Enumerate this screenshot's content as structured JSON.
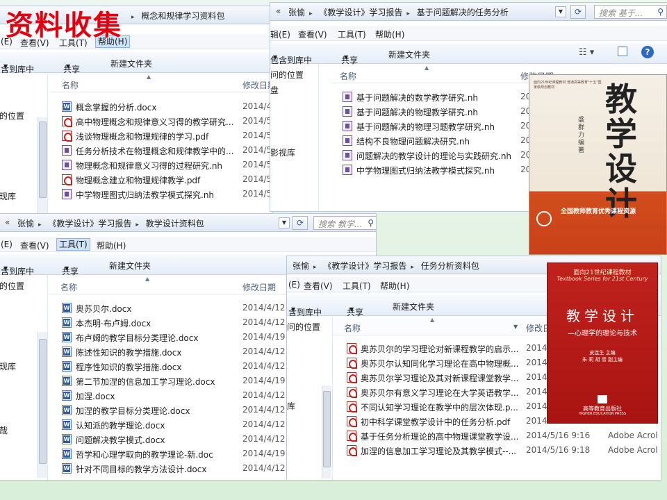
{
  "slide_title": "资料收集",
  "win1": {
    "breadcrumb": "概念和规律学习资料包",
    "menu": [
      "(E)",
      "查看(V)",
      "工具(T)",
      "帮助(H)"
    ],
    "toolbar": [
      "含到库中",
      "共享",
      "新建文件夹"
    ],
    "side": [
      "的位置",
      "现库"
    ],
    "col_name": "名称",
    "col_date": "修改日期",
    "files": [
      {
        "icon": "docx",
        "name": "概念掌握的分析.docx",
        "date": "2014/4"
      },
      {
        "icon": "pdf",
        "name": "高中物理概念和规律意义习得的教学研究...",
        "date": "2014/5"
      },
      {
        "icon": "pdf",
        "name": "浅谈物理概念和物理规律的学习.pdf",
        "date": "2014/5"
      },
      {
        "icon": "nh",
        "name": "任务分析技术在物理概念和规律教学中的...",
        "date": "2014/5"
      },
      {
        "icon": "nh",
        "name": "物理概念和规律意义习得的过程研究.nh",
        "date": "2014/5"
      },
      {
        "icon": "pdf",
        "name": "物理概念建立和物理规律教学.pdf",
        "date": "2014/5"
      },
      {
        "icon": "nh",
        "name": "中学物理图式归纳法教学模式探究.nh",
        "date": "2014/5"
      }
    ]
  },
  "win2": {
    "breadcrumb": [
      "张愉",
      "《教学设计》学习报告",
      "基于问题解决的任务分析"
    ],
    "search_placeholder": "搜索 基于...",
    "menu": [
      "辑(E)",
      "查看(V)",
      "工具(T)",
      "帮助(H)"
    ],
    "toolbar": [
      "包含到库中",
      "共享",
      "新建文件夹"
    ],
    "side": [
      "问的位置",
      "盘",
      "影视库"
    ],
    "col_name": "名称",
    "col_date": "修改日期",
    "files": [
      {
        "icon": "nh",
        "name": "基于问题解决的数学教学研究.nh",
        "date": "20"
      },
      {
        "icon": "nh",
        "name": "基于问题解决的物理教学研究.nh",
        "date": "20"
      },
      {
        "icon": "nh",
        "name": "基于问题解决的物理习题教学研究.nh",
        "date": "20"
      },
      {
        "icon": "nh",
        "name": "结构不良物理问题解决研究.nh",
        "date": "20"
      },
      {
        "icon": "nh",
        "name": "问题解决的教学设计的理论与实践研究.nh",
        "date": "20"
      },
      {
        "icon": "nh",
        "name": "中学物理图式归纳法教学模式探究.nh",
        "date": "20"
      }
    ]
  },
  "win3": {
    "breadcrumb": [
      "张愉",
      "《教学设计》学习报告",
      "教学设计资料包"
    ],
    "search_placeholder": "搜索 教学...",
    "menu": [
      "(E)",
      "查看(V)",
      "工具(T)",
      "帮助(H)"
    ],
    "toolbar": [
      "含到库中",
      "共享",
      "新建文件夹"
    ],
    "side": [
      "的位置",
      "现库",
      "哉"
    ],
    "col_name": "名称",
    "col_date": "修改日期",
    "files": [
      {
        "icon": "docx",
        "name": "奥苏贝尔.docx",
        "date": "2014/4/12 1"
      },
      {
        "icon": "docx",
        "name": "本杰明·布卢姆.docx",
        "date": "2014/4/12 1"
      },
      {
        "icon": "docx",
        "name": "布卢姆的教学目标分类理论.docx",
        "date": "2014/4/19 1"
      },
      {
        "icon": "docx",
        "name": "陈述性知识的教学措施.docx",
        "date": "2014/4/12 1"
      },
      {
        "icon": "docx",
        "name": "程序性知识的教学措施.docx",
        "date": "2014/4/12 1"
      },
      {
        "icon": "docx",
        "name": "第二节加涅的信息加工学习理论.docx",
        "date": "2014/4/19 1"
      },
      {
        "icon": "docx",
        "name": "加涅.docx",
        "date": "2014/4/12 1"
      },
      {
        "icon": "docx",
        "name": "加涅的教学目标分类理论.docx",
        "date": "2014/4/12 1"
      },
      {
        "icon": "docx",
        "name": "认知派的教学理论.docx",
        "date": "2014/4/12 1"
      },
      {
        "icon": "docx",
        "name": "问题解决教学模式.docx",
        "date": "2014/4/12 1"
      },
      {
        "icon": "docx",
        "name": "哲学和心理学取向的教学理论-新.doc",
        "date": "2014/4/19 1"
      },
      {
        "icon": "docx",
        "name": "针对不同目标的教学方法设计.docx",
        "date": "2014/4/12 1"
      }
    ]
  },
  "win4": {
    "breadcrumb": [
      "张愉",
      "《教学设计》学习报告",
      "任务分析资料包"
    ],
    "menu": [
      "(E)",
      "查看(V)",
      "工具(T)",
      "帮助(H)"
    ],
    "toolbar": [
      "含到库中",
      "共享",
      "新建文件夹"
    ],
    "side": [
      "问的位置",
      "库"
    ],
    "col_name": "名称",
    "col_date": "修改日",
    "files": [
      {
        "icon": "pdf",
        "name": "奥苏贝尔的学习理论对新课程教学的启示...",
        "date": "2014",
        "type": ""
      },
      {
        "icon": "pdf",
        "name": "奥苏贝尔认知同化学习理论在高中物理概...",
        "date": "2014",
        "type": ""
      },
      {
        "icon": "pdf",
        "name": "奥苏贝尔学习理论及其对新课程课堂教学...",
        "date": "2014",
        "type": ""
      },
      {
        "icon": "pdf",
        "name": "奥苏贝尔有意义学习理论在大学英语教学...",
        "date": "2014",
        "type": ""
      },
      {
        "icon": "pdf",
        "name": "不同认知学习理论在教学中的层次体现.p...",
        "date": "2014",
        "type": ""
      },
      {
        "icon": "pdf",
        "name": "初中科学课堂教学设计中的任务分析.pdf",
        "date": "2014",
        "type": ""
      },
      {
        "icon": "pdf",
        "name": "基于任务分析理论的高中物理课堂教学设...",
        "date": "2014/5/16 9:16",
        "type": "Adobe Acrol"
      },
      {
        "icon": "pdf",
        "name": "加涅的信息加工学习理论及其教学模式--...",
        "date": "2014/5/16 9:18",
        "type": "Adobe Acrol"
      }
    ]
  },
  "book1": {
    "title": "教学设计",
    "author": "盛群力 编著",
    "series": "全国教师教育优秀课程资源",
    "top_note": "面向21世纪课程教材 普通高等教育\"十五\"国家级规划教材"
  },
  "book2": {
    "series_cn": "面向21世纪课程教材",
    "series_en": "Textbook Series for 21st Century",
    "title": "教学设计",
    "subtitle": "—心理学的理论与技术",
    "authors": "皮连生 主编\n朱 莉 胡 雪 副主编",
    "publisher": "高等教育出版社",
    "publisher_en": "HIGHER EDUCATION PRESS"
  }
}
